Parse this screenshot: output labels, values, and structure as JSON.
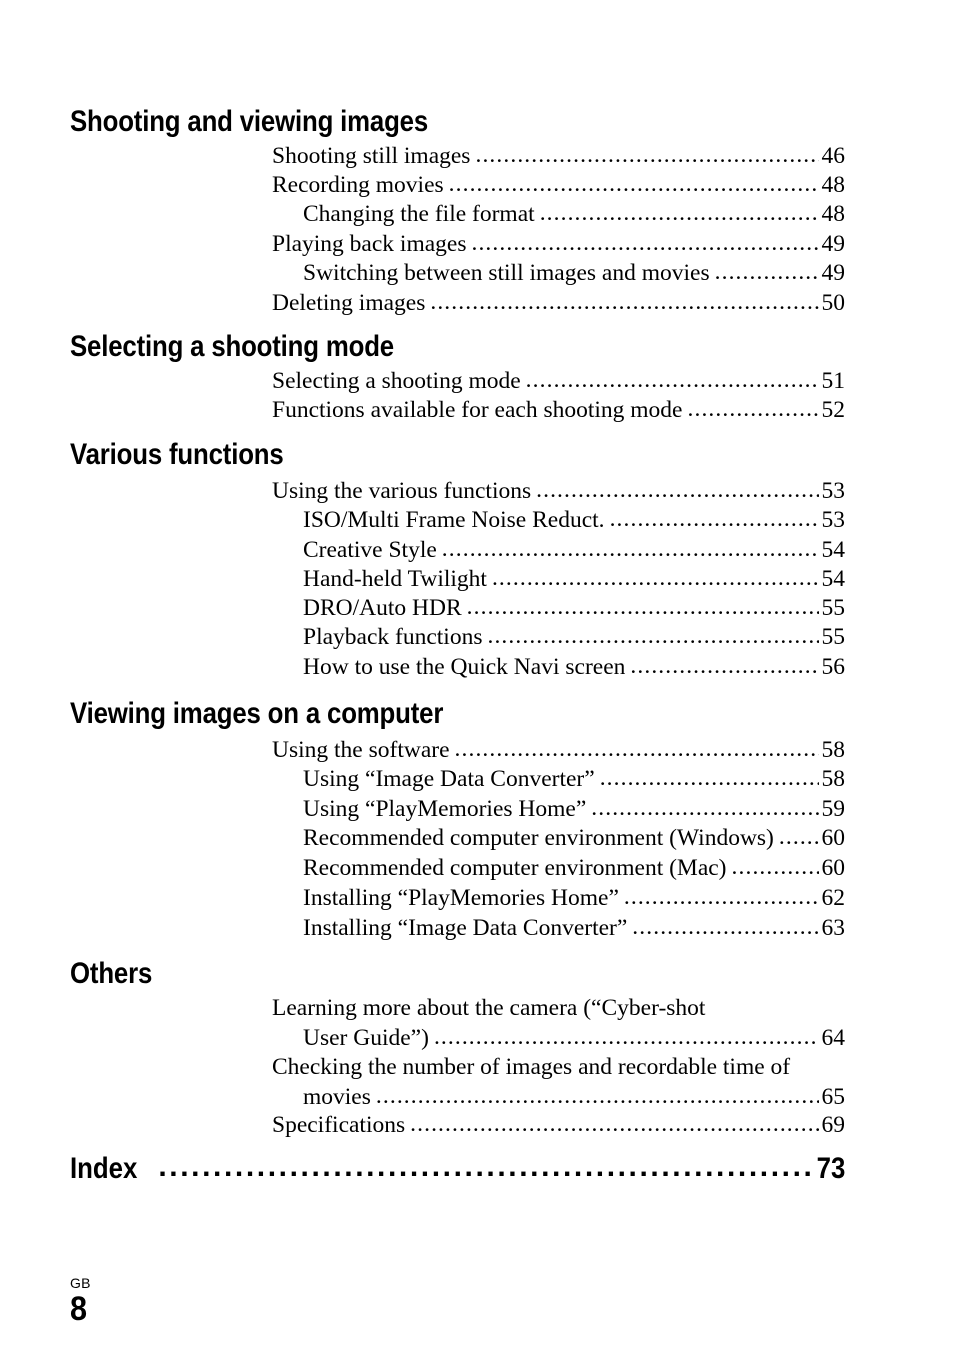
{
  "document": {
    "type": "table-of-contents",
    "footer": {
      "region_code": "GB",
      "page_number": "8"
    }
  },
  "sections": [
    {
      "heading": "Shooting and viewing images",
      "entries": [
        {
          "label": "Shooting still images",
          "page": "46",
          "level": 1,
          "gap": true
        },
        {
          "label": "Recording movies",
          "page": "48",
          "level": 1,
          "gap": false
        },
        {
          "label": "Changing the file format",
          "page": "48",
          "level": 2,
          "gap": true
        },
        {
          "label": "Playing back images",
          "page": "49",
          "level": 1,
          "gap": true
        },
        {
          "label": "Switching between still images and movies",
          "page": "49",
          "level": 2,
          "gap": true
        },
        {
          "label": "Deleting images",
          "page": "50",
          "level": 1,
          "gap": false
        }
      ]
    },
    {
      "heading": "Selecting a shooting mode",
      "entries": [
        {
          "label": "Selecting a shooting mode",
          "page": "51",
          "level": 1,
          "gap": true
        },
        {
          "label": "Functions available for each shooting mode",
          "page": "52",
          "level": 1,
          "gap": true
        }
      ]
    },
    {
      "heading": "Various functions",
      "entries": [
        {
          "label": "Using the various functions",
          "page": "53",
          "level": 1,
          "gap": true
        },
        {
          "label": "ISO/Multi Frame Noise Reduct.",
          "page": "53",
          "level": 2,
          "gap": true
        },
        {
          "label": "Creative Style",
          "page": "54",
          "level": 2,
          "gap": true
        },
        {
          "label": "Hand-held Twilight",
          "page": "54",
          "level": 2,
          "gap": true
        },
        {
          "label": "DRO/Auto HDR",
          "page": "55",
          "level": 2,
          "gap": false
        },
        {
          "label": "Playback functions",
          "page": "55",
          "level": 2,
          "gap": true
        },
        {
          "label": "How to use the Quick Navi screen",
          "page": "56",
          "level": 2,
          "gap": true
        }
      ]
    },
    {
      "heading": "Viewing images on a computer",
      "entries": [
        {
          "label": "Using the software",
          "page": "58",
          "level": 1,
          "gap": true
        },
        {
          "label": "Using “Image Data Converter”",
          "page": "58",
          "level": 2,
          "gap": true
        },
        {
          "label": "Using “PlayMemories Home”",
          "page": "59",
          "level": 2,
          "gap": false
        },
        {
          "label": "Recommended computer environment (Windows)",
          "page": "60",
          "level": 2,
          "gap": true
        },
        {
          "label": "Recommended computer environment (Mac)",
          "page": "60",
          "level": 2,
          "gap": false
        },
        {
          "label": "Installing “PlayMemories Home”",
          "page": "62",
          "level": 2,
          "gap": true
        },
        {
          "label": "Installing “Image Data Converter”",
          "page": "63",
          "level": 2,
          "gap": false
        }
      ]
    },
    {
      "heading": "Others",
      "entries": [
        {
          "label_line1": "Learning more about the camera (“Cyber-shot",
          "label_line2": "User Guide”)",
          "page": "64",
          "level": 1,
          "wrapped": true,
          "gap": true
        },
        {
          "label_line1": "Checking the number of images and recordable time of",
          "label_line2": "movies",
          "page": "65",
          "level": 1,
          "wrapped": true,
          "gap": true
        },
        {
          "label": "Specifications",
          "page": "69",
          "level": 1,
          "gap": true
        }
      ]
    }
  ],
  "index": {
    "label": "Index",
    "page": "73"
  },
  "leaders": {
    "serif_dots": "......................................................................................................................",
    "bold_dots": "..........................................................................."
  }
}
